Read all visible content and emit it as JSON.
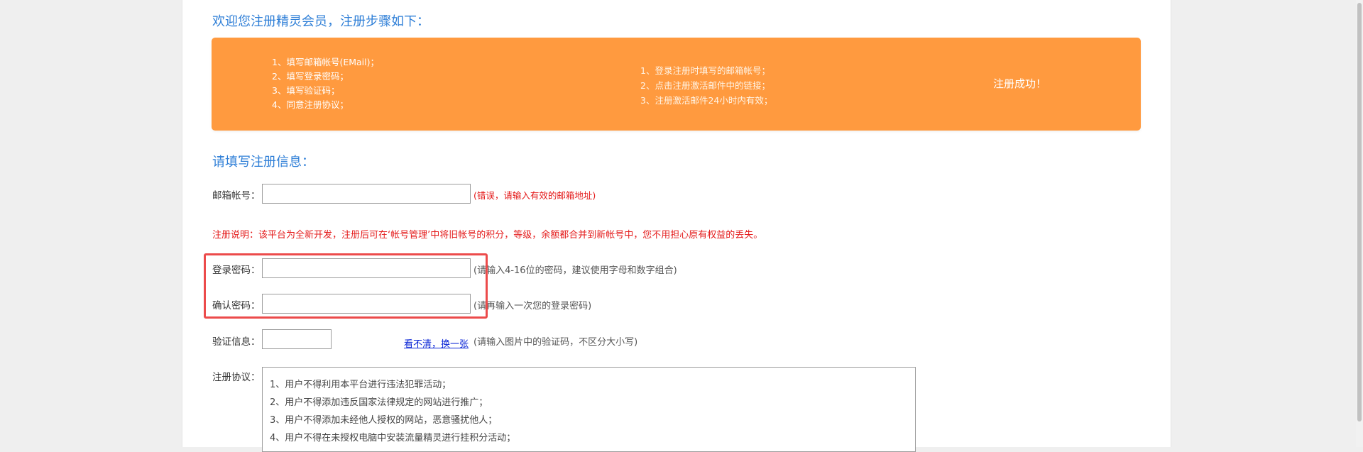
{
  "headings": {
    "welcome": "欢迎您注册精灵会员，注册步骤如下：",
    "fill_info": "请填写注册信息："
  },
  "steps": {
    "step1": [
      "1、填写邮箱帐号(EMail)；",
      "2、填写登录密码；",
      "3、填写验证码；",
      "4、同意注册协议；"
    ],
    "step2": [
      "1、登录注册时填写的邮箱帐号；",
      "2、点击注册激活邮件中的链接；",
      "3、注册激活邮件24小时内有效；"
    ],
    "step3": "注册成功！",
    "color": "#ff9a3f"
  },
  "form": {
    "email": {
      "label": "邮箱帐号：",
      "value": "",
      "error": "(错误，请输入有效的邮箱地址)"
    },
    "notice": "注册说明：该平台为全新开发，注册后可在‘帐号管理’中将旧帐号的积分，等级，余额都合并到新帐号中，您不用担心原有权益的丢失。",
    "password": {
      "label": "登录密码：",
      "value": "",
      "hint": "(请输入4-16位的密码，建议使用字母和数字组合)"
    },
    "confirm_password": {
      "label": "确认密码：",
      "value": "",
      "hint": "(请再输入一次您的登录密码)"
    },
    "captcha": {
      "label": "验证信息：",
      "value": "",
      "refresh_link": "看不清，换一张",
      "hint": "(请输入图片中的验证码，不区分大小写)"
    },
    "agreement": {
      "label": "注册协议：",
      "items": [
        "1、用户不得利用本平台进行违法犯罪活动；",
        "2、用户不得添加违反国家法律规定的网站进行推广；",
        "3、用户不得添加未经他人授权的网站，恶意骚扰他人；",
        "4、用户不得在未授权电脑中安装流量精灵进行挂积分活动；"
      ]
    }
  },
  "colors": {
    "heading_blue": "#2f7fd7",
    "error_red": "#e41a1a",
    "highlight_red": "#ec4b4b",
    "link_blue": "#0a25d6"
  }
}
